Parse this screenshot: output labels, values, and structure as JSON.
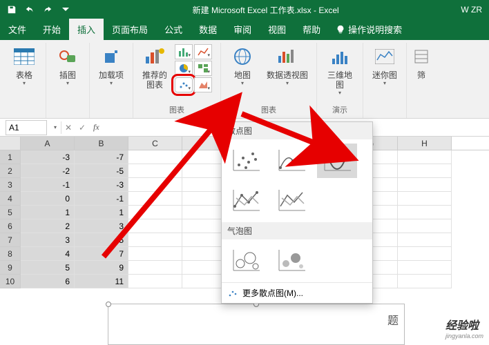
{
  "title": "新建 Microsoft Excel 工作表.xlsx  -  Excel",
  "user": "W ZR",
  "tabs": {
    "file": "文件",
    "home": "开始",
    "insert": "插入",
    "layout": "页面布局",
    "formulas": "公式",
    "data": "数据",
    "review": "审阅",
    "view": "视图",
    "help": "帮助",
    "tell_me": "操作说明搜索"
  },
  "ribbon": {
    "tables": {
      "label": "表格",
      "btn": "表格"
    },
    "illustrations": {
      "label": "插图",
      "btn": "插图"
    },
    "addins": {
      "label": "加载\n项",
      "btn": "加载项"
    },
    "charts": {
      "label": "图表",
      "recommended": "推荐的\n图表"
    },
    "maps": {
      "btn": "地图"
    },
    "pivotchart": {
      "btn": "数据透视图"
    },
    "maps3d": {
      "label": "演示",
      "btn": "三维地\n图"
    },
    "sparklines": {
      "label": "迷你图",
      "btn": "迷你图"
    },
    "filters": {
      "btn": "筛"
    }
  },
  "dropdown": {
    "section1": "散点图",
    "section2": "气泡图",
    "more": "更多散点图(M)..."
  },
  "namebox": "A1",
  "columns": [
    "A",
    "B",
    "C",
    "",
    "",
    "",
    "G",
    "H"
  ],
  "rows": [
    "1",
    "2",
    "3",
    "4",
    "5",
    "6",
    "7",
    "8",
    "9",
    "10"
  ],
  "cells": {
    "A": [
      "-3",
      "-2",
      "-1",
      "0",
      "1",
      "2",
      "3",
      "4",
      "5",
      "6"
    ],
    "B": [
      "-7",
      "-5",
      "-3",
      "-1",
      "1",
      "3",
      "5",
      "7",
      "9",
      "11"
    ]
  },
  "chart_title_partial": "题",
  "chart_data": {
    "type": "scatter",
    "x": [
      -3,
      -2,
      -1,
      0,
      1,
      2,
      3,
      4,
      5,
      6
    ],
    "y": [
      -7,
      -5,
      -3,
      -1,
      1,
      3,
      5,
      7,
      9,
      11
    ],
    "title": "",
    "xlabel": "",
    "ylabel": ""
  },
  "watermark": {
    "main": "经验啦",
    "sub": "jingyanla.com"
  }
}
